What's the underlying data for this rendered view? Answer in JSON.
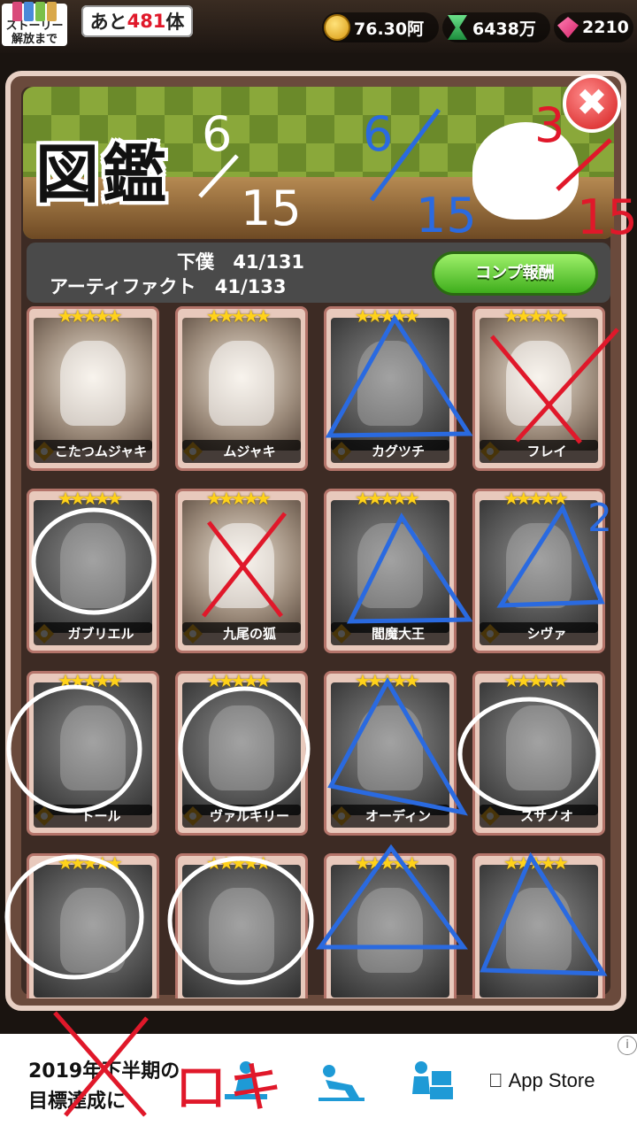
{
  "topbar": {
    "story_label_1": "ストーリー",
    "story_label_2": "解放まで",
    "remain_prefix": "あと",
    "remain_count": "481",
    "remain_suffix": "体",
    "coins": "76.30阿",
    "time": "6438万",
    "gems": "2210"
  },
  "panel": {
    "title": "図鑑",
    "close_label": "✖",
    "stats": {
      "servants_label": "下僕",
      "servants_value": "41/131",
      "artifacts_label": "アーティファクト",
      "artifacts_value": "41/133"
    },
    "comp_button": "コンプ報酬"
  },
  "cards": [
    {
      "name": "こたつムジャキ",
      "dim": false
    },
    {
      "name": "ムジャキ",
      "dim": false
    },
    {
      "name": "カグツチ",
      "dim": true
    },
    {
      "name": "フレイ",
      "dim": false
    },
    {
      "name": "ガブリエル",
      "dim": true
    },
    {
      "name": "九尾の狐",
      "dim": false
    },
    {
      "name": "閻魔大王",
      "dim": true
    },
    {
      "name": "シヴァ",
      "dim": true
    },
    {
      "name": "トール",
      "dim": true
    },
    {
      "name": "ヴァルキリー",
      "dim": true
    },
    {
      "name": "オーディン",
      "dim": true
    },
    {
      "name": "スサノオ",
      "dim": true
    },
    {
      "name": "",
      "dim": true
    },
    {
      "name": "",
      "dim": true
    },
    {
      "name": "",
      "dim": true
    },
    {
      "name": "",
      "dim": true
    }
  ],
  "handwriting": {
    "frac1_top": "6",
    "frac1_bottom": "15",
    "frac2_top": "6",
    "frac2_bottom": "15",
    "frac3_top": "3",
    "frac3_bottom": "15",
    "mark_q": "2",
    "ad_scrawl": "ロキ"
  },
  "ad": {
    "line1": "2019年下半期の",
    "line2": "目標達成に",
    "store": "App Store",
    "info": "i"
  },
  "colors": {
    "blue_mark": "#2a6ae0",
    "red_mark": "#e0182a",
    "white_mark": "#ffffff",
    "star": "#ffd21a",
    "green_button": "#3fae1c"
  }
}
